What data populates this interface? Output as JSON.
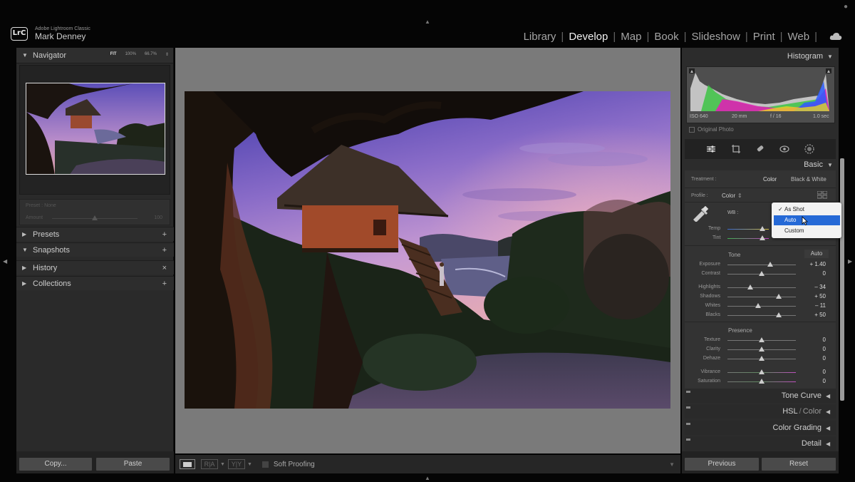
{
  "app": {
    "logo": "LrC",
    "product": "Adobe Lightroom Classic",
    "user": "Mark Denney"
  },
  "modules": [
    {
      "label": "Library",
      "active": false
    },
    {
      "label": "Develop",
      "active": true
    },
    {
      "label": "Map",
      "active": false
    },
    {
      "label": "Book",
      "active": false
    },
    {
      "label": "Slideshow",
      "active": false
    },
    {
      "label": "Print",
      "active": false
    },
    {
      "label": "Web",
      "active": false
    }
  ],
  "left": {
    "navigator": {
      "label": "Navigator",
      "fit": "FIT",
      "z1": "100%",
      "z2": "66.7%",
      "caret": "⇕"
    },
    "preset": {
      "name": "Preset : None",
      "amount_label": "Amount",
      "amount_value": "100"
    },
    "panels": [
      {
        "label": "Presets",
        "tri": "▶",
        "action": "+"
      },
      {
        "label": "Snapshots",
        "tri": "▼",
        "action": "+"
      },
      {
        "label": "History",
        "tri": "▶",
        "action": "×"
      },
      {
        "label": "Collections",
        "tri": "▶",
        "action": "+"
      }
    ],
    "copy_label": "Copy...",
    "paste_label": "Paste"
  },
  "toolbar": {
    "soft_proofing": "Soft Proofing",
    "ra": "R|A",
    "yy": "Y|Y"
  },
  "right": {
    "histogram": {
      "label": "Histogram",
      "iso": "ISO 640",
      "focal": "20 mm",
      "aperture": "f / 16",
      "shutter": "1.0 sec",
      "original_photo": "Original Photo"
    },
    "basic": {
      "label": "Basic",
      "treatment_label": "Treatment :",
      "treatment_color": "Color",
      "treatment_bw": "Black & White",
      "profile_label": "Profile :",
      "profile_value": "Color",
      "wb_label": "WB :",
      "temp_label": "Temp",
      "tint_label": "Tint",
      "tone_label": "Tone",
      "auto_label": "Auto",
      "presence_label": "Presence",
      "tone": [
        {
          "label": "Exposure",
          "value": "+ 1.40",
          "pos": 0.63
        },
        {
          "label": "Contrast",
          "value": "0",
          "pos": 0.5
        },
        {
          "label": "Highlights",
          "value": "– 34",
          "pos": 0.33
        },
        {
          "label": "Shadows",
          "value": "+ 50",
          "pos": 0.75
        },
        {
          "label": "Whites",
          "value": "– 11",
          "pos": 0.45
        },
        {
          "label": "Blacks",
          "value": "+ 50",
          "pos": 0.75
        }
      ],
      "presence": [
        {
          "label": "Texture",
          "value": "0",
          "pos": 0.5
        },
        {
          "label": "Clarity",
          "value": "0",
          "pos": 0.5
        },
        {
          "label": "Dehaze",
          "value": "0",
          "pos": 0.5
        },
        {
          "label": "Vibrance",
          "value": "0",
          "pos": 0.5
        },
        {
          "label": "Saturation",
          "value": "0",
          "pos": 0.5
        }
      ]
    },
    "wb_menu": {
      "options": [
        {
          "label": "As Shot",
          "checked": true,
          "selected": false
        },
        {
          "label": "Auto",
          "checked": false,
          "selected": true
        },
        {
          "label": "Custom",
          "checked": false,
          "selected": false
        }
      ]
    },
    "collapsed": [
      {
        "label": "Tone Curve"
      },
      {
        "label": "HSL",
        "label2": "Color"
      },
      {
        "label": "Color Grading"
      },
      {
        "label": "Detail"
      }
    ],
    "previous_label": "Previous",
    "reset_label": "Reset"
  },
  "colors": {
    "accent_blue": "#2569d6",
    "panel_bg": "#2c2c2c",
    "canvas_bg": "#7a7a7a"
  }
}
